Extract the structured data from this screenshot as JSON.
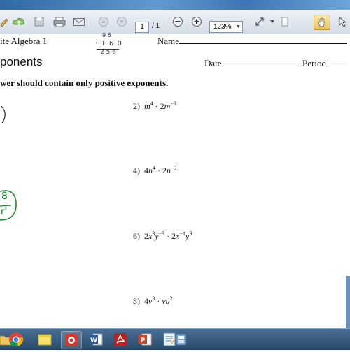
{
  "toolbar": {
    "page_current": "1",
    "page_total": "/ 1",
    "zoom": "123%"
  },
  "worksheet": {
    "course": "ite Algebra 1",
    "name_label": "Name",
    "title": "ponents",
    "date_label": "Date",
    "period_label": "Period",
    "instructions": "wer should contain only positive exponents."
  },
  "problems": [
    {
      "num": "2)"
    },
    {
      "num": "4)"
    },
    {
      "num": "6)"
    },
    {
      "num": "8)"
    }
  ],
  "handwriting": {
    "calc_top": "9 6",
    "calc_mid": "· 1 6 0",
    "calc_bottom": "2 5 6",
    "answer_num": "8",
    "answer_den": "r'"
  },
  "colors": {
    "ink_dark": "#333333",
    "ink_green": "#1f8a2e",
    "title_bar": "#3c78b4",
    "taskbar": "#27486b"
  },
  "taskbar_icons": [
    "folder-icon",
    "chrome-icon",
    "sticky-notes-icon",
    "camtasia-icon",
    "word-icon",
    "acrobat-icon",
    "powerpoint-icon",
    "notepad-icon",
    "settings-app-icon"
  ]
}
